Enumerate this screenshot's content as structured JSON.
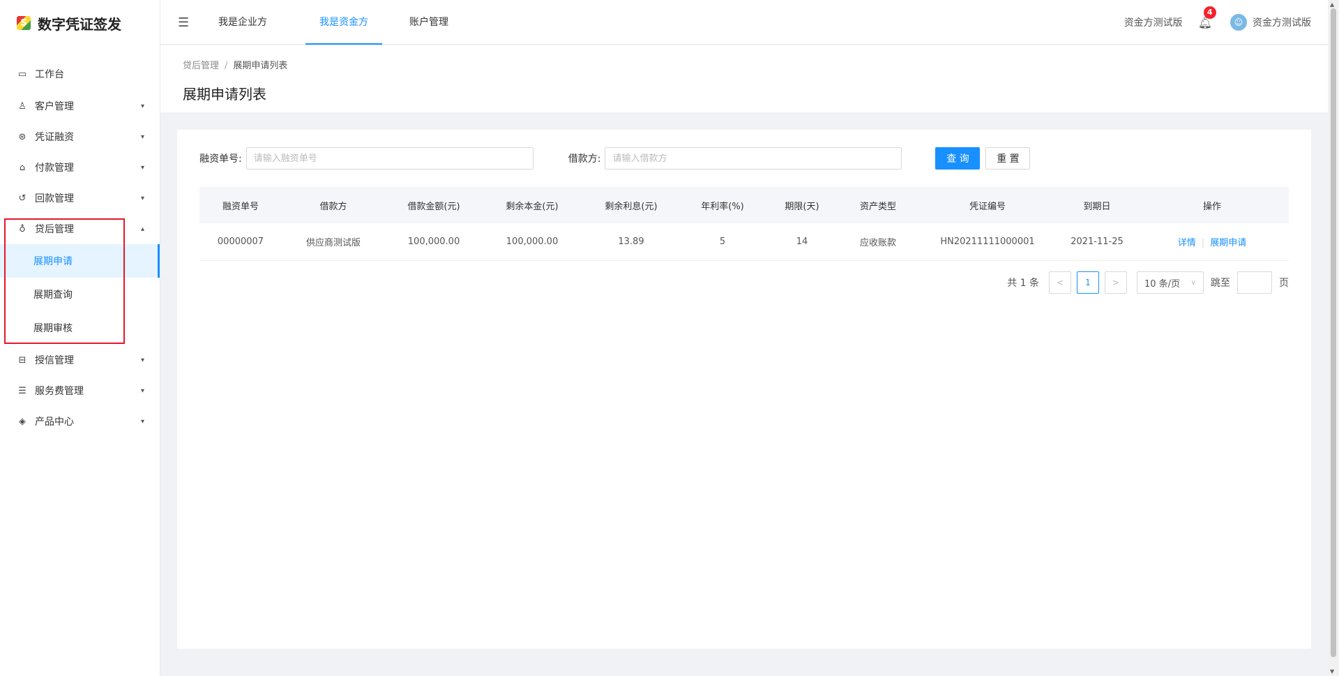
{
  "app": {
    "title": "数字凭证签发",
    "logo_glyph": "S"
  },
  "sidebar": {
    "items": [
      {
        "label": "工作台",
        "icon": "dashboard-icon",
        "glyph": "▭"
      },
      {
        "label": "客户管理",
        "icon": "users-icon",
        "glyph": "♙"
      },
      {
        "label": "凭证融资",
        "icon": "voucher-icon",
        "glyph": "⊛"
      },
      {
        "label": "付款管理",
        "icon": "payment-icon",
        "glyph": "⌂"
      },
      {
        "label": "回款管理",
        "icon": "refund-icon",
        "glyph": "↺"
      },
      {
        "label": "贷后管理",
        "icon": "loan-icon",
        "glyph": "♁"
      }
    ],
    "loan_sub": [
      "展期申请",
      "展期查询",
      "展期审核"
    ],
    "lower_items": [
      {
        "label": "授信管理",
        "icon": "credit-icon",
        "glyph": "⊟"
      },
      {
        "label": "服务费管理",
        "icon": "fee-icon",
        "glyph": "☰"
      },
      {
        "label": "产品中心",
        "icon": "layers-icon",
        "glyph": "◈"
      }
    ]
  },
  "header": {
    "tabs": [
      "我是企业方",
      "我是资金方",
      "账户管理"
    ],
    "org_name": "资金方测试版",
    "notification_count": "4",
    "user_name": "资金方测试版"
  },
  "breadcrumb": {
    "parent": "贷后管理",
    "separator": "/",
    "current": "展期申请列表"
  },
  "page_title": "展期申请列表",
  "filter": {
    "finance_no_label": "融资单号:",
    "finance_no_placeholder": "请输入融资单号",
    "borrower_label": "借款方:",
    "borrower_placeholder": "请输入借款方",
    "search_label": "查 询",
    "reset_label": "重 置"
  },
  "table": {
    "columns": [
      "融资单号",
      "借款方",
      "借款金额(元)",
      "剩余本金(元)",
      "剩余利息(元)",
      "年利率(%)",
      "期限(天)",
      "资产类型",
      "凭证编号",
      "到期日",
      "操作"
    ],
    "rows": [
      [
        "00000007",
        "供应商测试版",
        "100,000.00",
        "100,000.00",
        "13.89",
        "5",
        "14",
        "应收账款",
        "HN20211111000001",
        "2021-11-25"
      ]
    ],
    "action_detail": "详情",
    "action_extend": "展期申请"
  },
  "pagination": {
    "total_text": "共 1 条",
    "current_page": "1",
    "page_size": "10 条/页",
    "jump_label": "跳至",
    "page_suffix": "页"
  },
  "colors": {
    "accent": "#1890ff",
    "highlight_box": "#e5162b",
    "badge": "#f5222d"
  }
}
